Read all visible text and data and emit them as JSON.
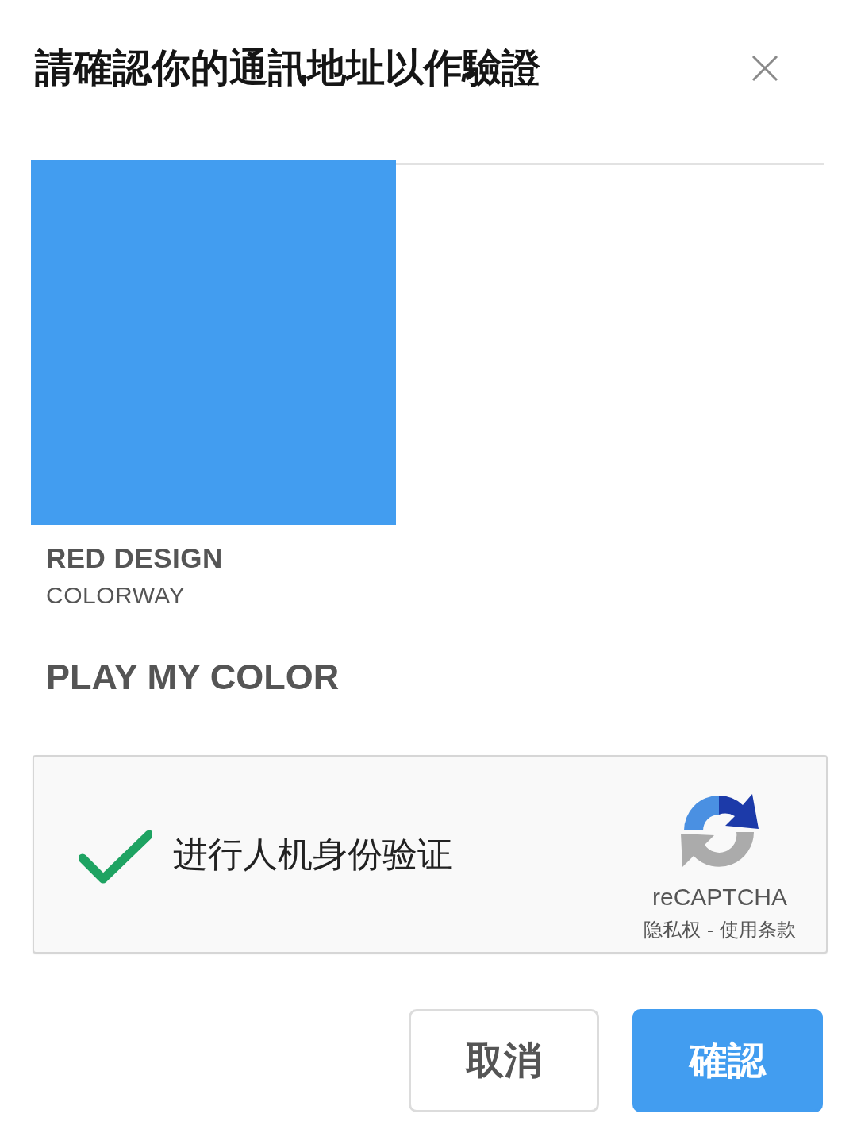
{
  "dialog": {
    "title": "請確認你的通訊地址以作驗證"
  },
  "product": {
    "name": "RED DESIGN",
    "subtitle": "COLORWAY"
  },
  "section_title": "PLAY MY COLOR",
  "captcha": {
    "checked": true,
    "label": "进行人机身份验证",
    "brand": "reCAPTCHA",
    "privacy_link": "隐私权",
    "separator": "-",
    "terms_link": "使用条款"
  },
  "buttons": [
    {
      "label": "取消",
      "kind": "secondary"
    },
    {
      "label": "確認",
      "kind": "primary"
    }
  ]
}
